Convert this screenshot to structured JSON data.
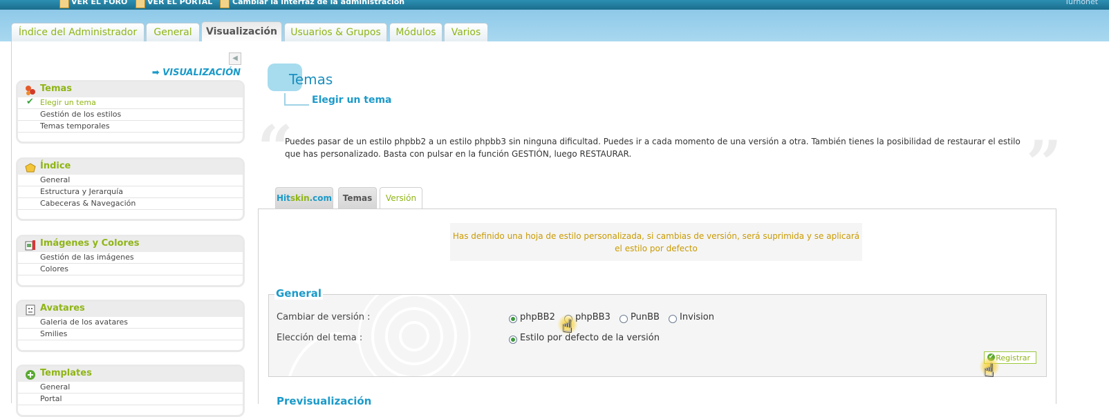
{
  "topbar": {
    "links": [
      "VER EL FORO",
      "VER EL PORTAL",
      "Cambiar la interfaz de la administración"
    ],
    "user": "Turnonet"
  },
  "tabs": [
    "Índice del Administrador",
    "General",
    "Visualización",
    "Usuarios & Grupos",
    "Módulos",
    "Varios"
  ],
  "sidebar": {
    "section_title": "➡ VISUALIZACIÓN",
    "groups": [
      {
        "title": "Temas",
        "items": [
          "Elegir un tema",
          "Gestión de los estilos",
          "Temas temporales"
        ]
      },
      {
        "title": "Índice",
        "items": [
          "General",
          "Estructura y Jerarquía",
          "Cabeceras & Navegación"
        ]
      },
      {
        "title": "Imágenes y Colores",
        "items": [
          "Gestión de las imágenes",
          "Colores"
        ]
      },
      {
        "title": "Avatares",
        "items": [
          "Galeria de los avatares",
          "Smilies"
        ]
      },
      {
        "title": "Templates",
        "items": [
          "General",
          "Portal"
        ]
      }
    ]
  },
  "main": {
    "title": "Temas",
    "subtitle": "Elegir un tema",
    "description": "Puedes pasar de un estilo phpbb2 a un estilo phpbb3 sin ninguna dificultad. Puedes ir a cada momento de una versión a otra. También tienes la posibilidad de restaurar el estilo que has personalizado. Basta con pulsar en la función GESTIÓN, luego RESTAURAR.",
    "inner_tabs": {
      "hitskin_a": "Hit",
      "hitskin_b": "skin",
      "hitskin_c": ".com",
      "temas": "Temas",
      "version": "Versión"
    },
    "notice": "Has definido una hoja de estilo personalizada, si cambias de versión, será suprimida y se aplicará el estilo por defecto",
    "general_legend": "General",
    "change_version_label": "Cambiar de versión :",
    "version_options": [
      "phpBB2",
      "phpBB3",
      "PunBB",
      "Invision"
    ],
    "selected_version": "phpBB2",
    "theme_choice_label": "Elección del tema :",
    "theme_option": "Estilo por defecto de la versión",
    "save_button": "Registrar",
    "next_section": "Previsualización"
  },
  "colors": {
    "accent_green": "#8fb516",
    "accent_blue": "#1b9ac9",
    "notice_text": "#c99a00"
  }
}
